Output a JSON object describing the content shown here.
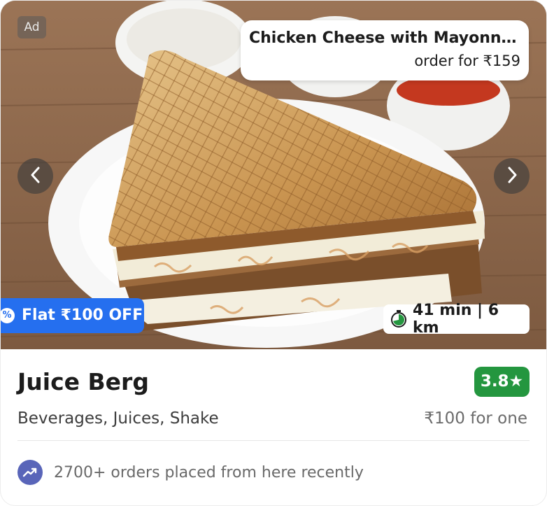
{
  "ad": {
    "label": "Ad"
  },
  "dish": {
    "name": "Chicken Cheese with Mayonnai...",
    "price": "order for ₹159"
  },
  "offer": {
    "label": "Flat ₹100 OFF",
    "icon": "percent-badge-icon",
    "color": "#256fef"
  },
  "delivery": {
    "eta": "41 min | 6 km",
    "icon": "timer-icon"
  },
  "restaurant": {
    "name": "Juice Berg",
    "rating": "3.8★",
    "rating_color": "#24963f",
    "cuisines": "Beverages, Juices, Shake",
    "price_for_one": "₹100 for one"
  },
  "footer": {
    "orders_text": "2700+ orders placed from here recently",
    "icon": "trending-up-icon"
  },
  "carousel": {
    "prev_icon": "chevron-left-icon",
    "next_icon": "chevron-right-icon"
  }
}
